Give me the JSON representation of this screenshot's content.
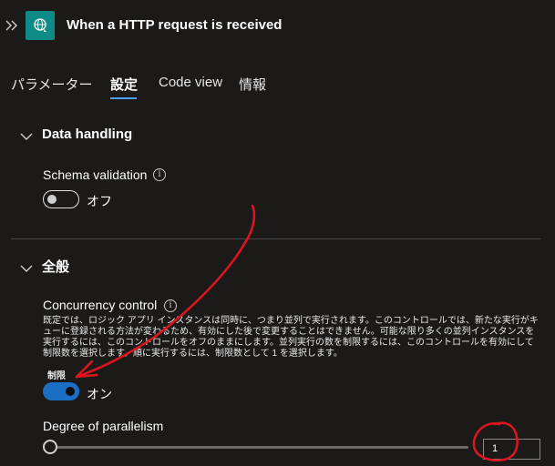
{
  "header": {
    "title": "When a HTTP request is received",
    "collapse_icon": "double-chevron-right-icon",
    "trigger_icon": "http-request-globe-icon"
  },
  "tabs": [
    {
      "label": "パラメーター",
      "active": false
    },
    {
      "label": "設定",
      "active": true
    },
    {
      "label": "Code view",
      "active": false
    },
    {
      "label": "情報",
      "active": false
    }
  ],
  "data_handling": {
    "title": "Data handling",
    "schema_validation": {
      "label": "Schema validation",
      "toggle_state": "off",
      "toggle_text": "オフ"
    }
  },
  "general": {
    "title": "全般",
    "concurrency": {
      "label": "Concurrency control",
      "description": "既定では、ロジック アプリ インスタンスは同時に、つまり並列で実行されます。このコントロールでは、新たな実行がキューに登録される方法が変わるため、有効にした後で変更することはできません。可能な限り多くの並列インスタンスを実行するには、このコントロールをオフのままにします。並列実行の数を制限するには、このコントロールを有効にして制限数を選択します。順に実行するには、制限数として 1 を選択します。",
      "limit_label": "制限",
      "toggle_state": "on",
      "toggle_text": "オン"
    },
    "parallelism": {
      "label": "Degree of parallelism",
      "value": "1",
      "slider_fraction": 0.0
    }
  },
  "colors": {
    "background": "#1b1a19",
    "accent": "#1a6fc4",
    "tab_underline": "#4f9dff",
    "trigger_icon_bg": "#0e8a87",
    "annotation": "#e0141e"
  }
}
